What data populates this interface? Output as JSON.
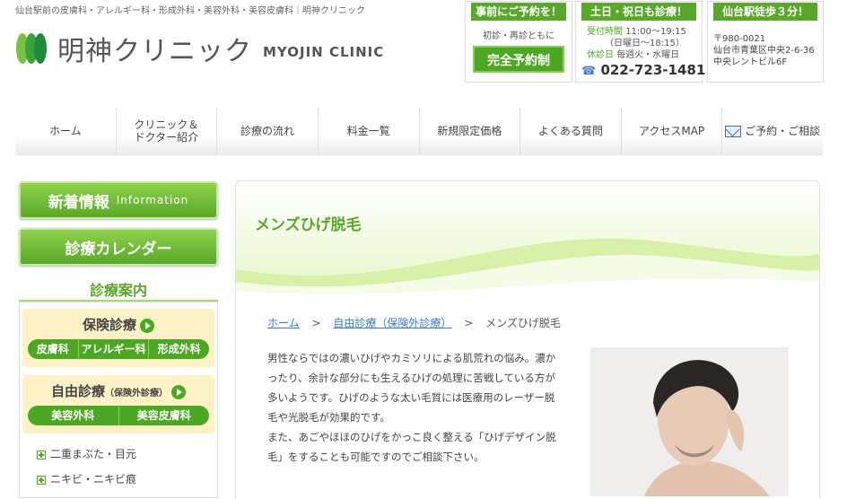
{
  "header": {
    "tagline": "仙台駅前の皮膚科・アレルギー科・形成外科・美容外科・美容皮膚科｜明神クリニック",
    "logo_ja": "明神クリニック",
    "logo_en": "MYOJIN CLINIC"
  },
  "reserve_box": {
    "title": "事前にご予約を！",
    "sub": "初診・再診ともに",
    "button": "完全予約制"
  },
  "hours_box": {
    "title": "土日・祝日も診療！",
    "hours_label": "受付時間",
    "hours_value": "11:00〜19:15",
    "hours_sub": "（日曜日〜18:15）",
    "closed_label": "休診日",
    "closed_value": "毎週火・水曜日",
    "phone": "022-723-1481"
  },
  "access_box": {
    "title": "仙台駅徒歩３分！",
    "postal": "〒980-0021",
    "address1": "仙台市青葉区中央2-6-36",
    "address2": "中央レントビル6F"
  },
  "nav": [
    {
      "l1": "ホーム",
      "l2": ""
    },
    {
      "l1": "クリニック＆",
      "l2": "ドクター紹介"
    },
    {
      "l1": "診療の流れ",
      "l2": ""
    },
    {
      "l1": "料金一覧",
      "l2": ""
    },
    {
      "l1": "新規限定価格",
      "l2": ""
    },
    {
      "l1": "よくある質問",
      "l2": ""
    },
    {
      "l1": "アクセスMAP",
      "l2": ""
    },
    {
      "l1": "ご予約・ご相談",
      "l2": ""
    }
  ],
  "sidebar": {
    "news": {
      "ja": "新着情報",
      "en": "Information"
    },
    "calendar": "診療カレンダー",
    "guide_title": "診療案内",
    "insurance": {
      "title": "保険診療",
      "items": [
        "皮膚科",
        "アレルギー科",
        "形成外科"
      ]
    },
    "self_pay": {
      "title": "自由診療",
      "note": "（保険外診療）",
      "items": [
        "美容外科",
        "美容皮膚科"
      ]
    },
    "links": [
      "二重まぶた・目元",
      "ニキビ・ニキビ痕"
    ]
  },
  "main": {
    "title": "メンズひげ脱毛",
    "breadcrumb": [
      "ホーム",
      "自由診療（保険外診療）",
      "メンズひげ脱毛"
    ],
    "breadcrumb_sep": ">",
    "intro": [
      "男性ならではの濃いひげやカミソリによる肌荒れの悩み。濃か",
      "ったり、余計な部分にも生えるひげの処理に苦戦している方が",
      "多いようです。ひげのような太い毛質には医療用のレーザー脱",
      "毛や光脱毛が効果的です。",
      "また、あごやほほのひげをかっこ良く整える「ひげデザイン脱",
      "毛」をすることも可能ですのでご相談下さい。"
    ]
  },
  "colors": {
    "brand_green": "#5aa82a",
    "link_blue": "#3a7bbf"
  }
}
